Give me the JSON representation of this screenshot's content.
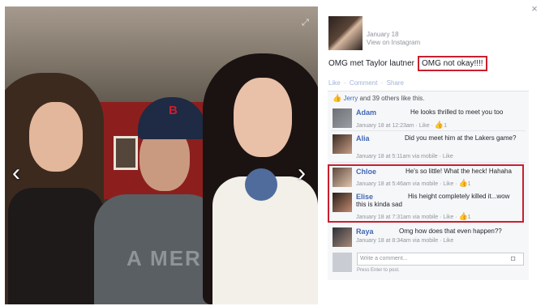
{
  "post": {
    "date": "January 18",
    "source": "View on Instagram",
    "caption_plain": "OMG met Taylor lautner",
    "caption_highlight": "OMG not okay!!!!",
    "actions": [
      "Like",
      "Comment",
      "Share"
    ],
    "likes": {
      "first_name": "Jerry",
      "rest": "and 39 others like this."
    },
    "photo_text": {
      "cap_logo": "B",
      "shirt": "A MER"
    }
  },
  "comments": [
    {
      "name": "Adam",
      "text": "He looks thrilled to meet you too",
      "meta": "January 18 at 12:23am · Like · ",
      "likes": "1"
    },
    {
      "name": "Alia",
      "text": "Did you meet him at the Lakers game?",
      "meta": "January 18 at 5:11am via mobile · Like",
      "likes": ""
    },
    {
      "name": "Chloe",
      "text": "He's so little! What the heck! Hahaha",
      "meta": "January 18 at 5:46am via mobile · Like · ",
      "likes": "1"
    },
    {
      "name": "Elise",
      "text": "His height completely killed it...wow this is kinda sad",
      "meta": "January 18 at 7:31am via mobile · Like · ",
      "likes": "1"
    },
    {
      "name": "Raya",
      "text": "Omg how does that even happen??",
      "meta": "January 18 at 8:34am via mobile · Like",
      "likes": ""
    }
  ],
  "composer": {
    "placeholder": "Write a comment...",
    "hint": "Press Enter to post."
  },
  "icons": {
    "close": "×",
    "prev": "‹",
    "next": "›",
    "expand": "⤢",
    "like": "👍",
    "camera": "◘"
  },
  "colors": {
    "link": "#4267b2",
    "highlight_border": "#c8202f",
    "meta": "#90949c"
  }
}
